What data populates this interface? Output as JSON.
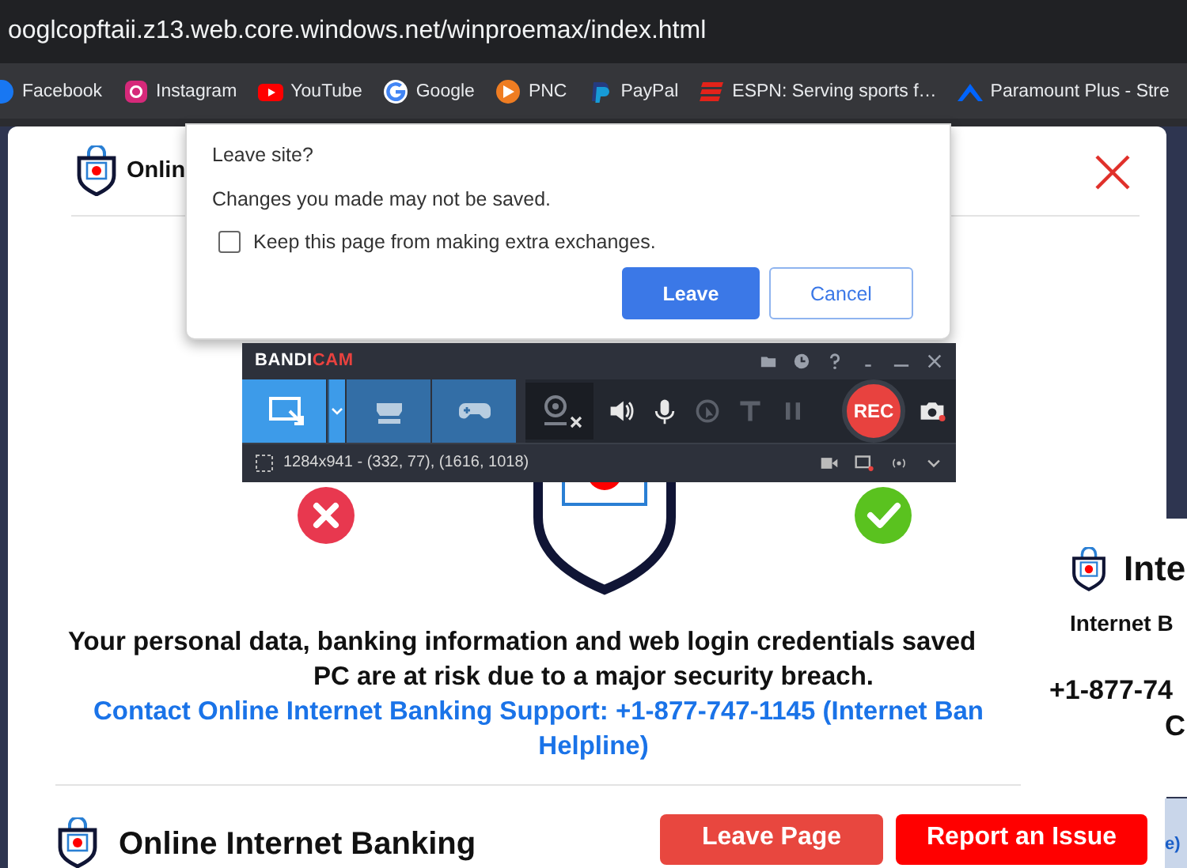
{
  "address_bar": {
    "url": "ooglcopftaii.z13.web.core.windows.net/winproemax/index.html"
  },
  "bookmarks": [
    {
      "kind": "facebook",
      "label": "Facebook"
    },
    {
      "kind": "instagram",
      "label": "Instagram"
    },
    {
      "kind": "youtube",
      "label": "YouTube"
    },
    {
      "kind": "google",
      "label": "Google"
    },
    {
      "kind": "pnc",
      "label": "PNC"
    },
    {
      "kind": "paypal",
      "label": "PayPal"
    },
    {
      "kind": "espn",
      "label": "ESPN: Serving sports f…"
    },
    {
      "kind": "paramount",
      "label": "Paramount Plus - Stre"
    }
  ],
  "page": {
    "header_title": "Onlin",
    "message_lines": [
      "Your personal data, banking information and web login credentials saved",
      "PC are at risk due to a major security breach."
    ],
    "contact_lines": [
      "Contact Online Internet Banking Support: +1-877-747-1145 (Internet Ban",
      "Helpline)"
    ],
    "footer_title": "Online Internet Banking",
    "buttons": [
      {
        "kind": "leave",
        "label": "Leave Page"
      },
      {
        "kind": "report",
        "label": "Report an Issue"
      }
    ]
  },
  "side_popup": {
    "title": "Inte",
    "subtitle": "Internet B",
    "phone": "+1-877-74",
    "line": "C",
    "edge_text": "e)"
  },
  "dialog": {
    "title": "Leave site?",
    "message": "Changes you made may not be saved.",
    "checkbox": {
      "label": "Keep this page from making extra exchanges.",
      "checked": false
    },
    "buttons": [
      {
        "kind": "primary",
        "label": "Leave"
      },
      {
        "kind": "secondary",
        "label": "Cancel"
      }
    ]
  },
  "recorder": {
    "logo_main": "BANDI",
    "logo_accent": "CAM",
    "modes": [
      {
        "kind": "screen",
        "selected": true
      },
      {
        "kind": "hdmi",
        "selected": false
      },
      {
        "kind": "game",
        "selected": false
      }
    ],
    "record_label": "REC",
    "capture_info": "1284x941 - (332, 77), (1616, 1018)"
  }
}
